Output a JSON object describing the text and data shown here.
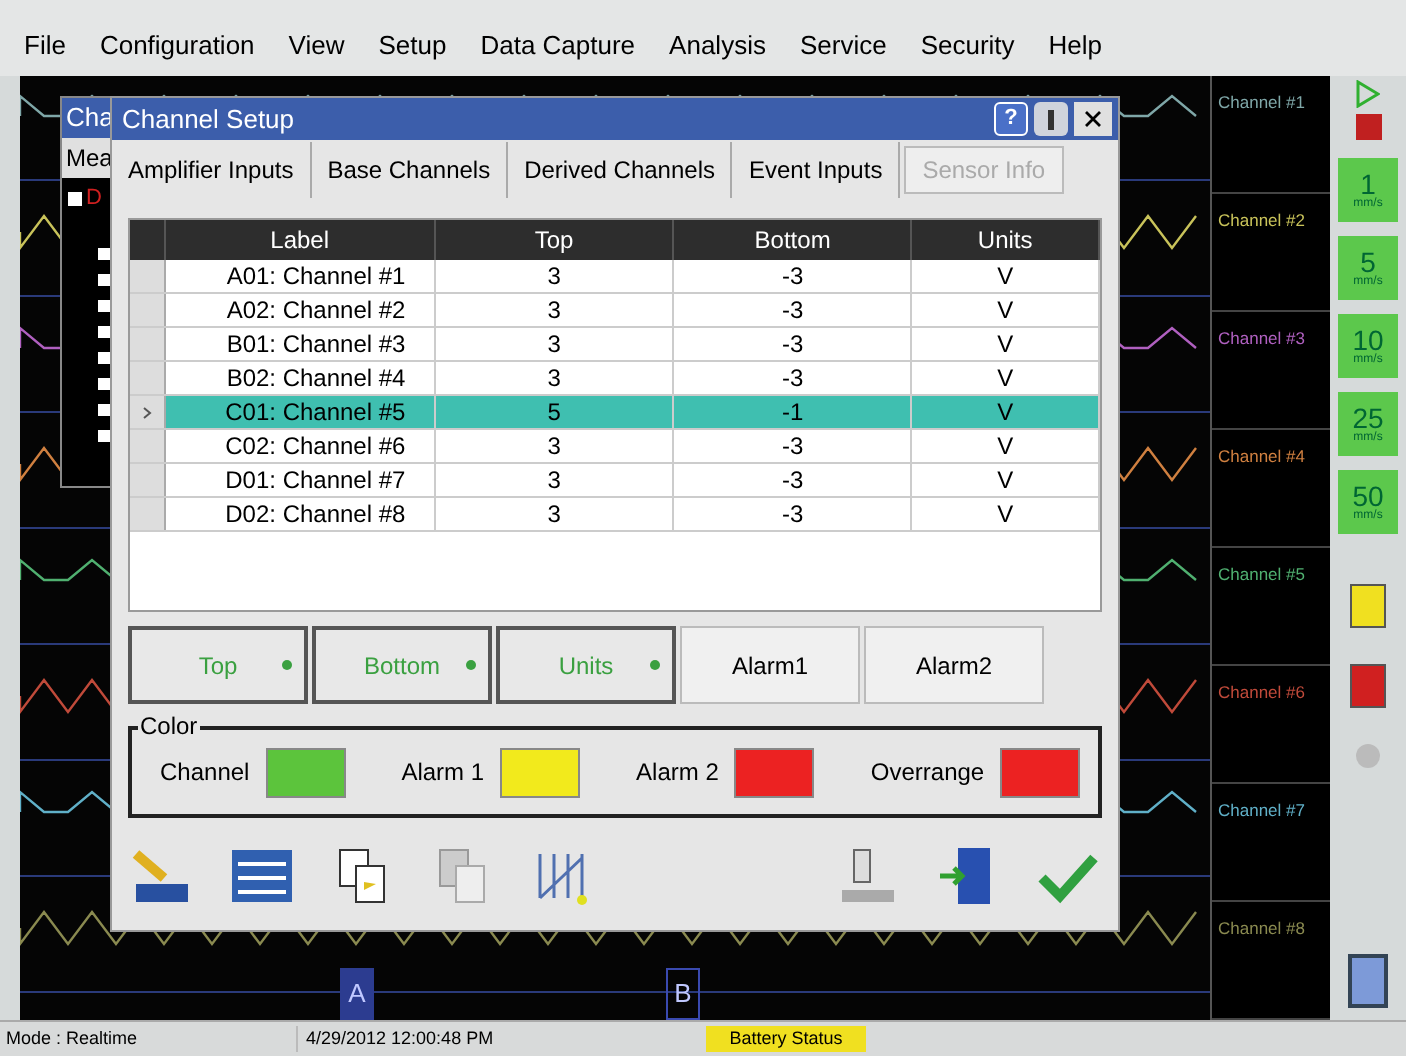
{
  "menu": [
    "File",
    "Configuration",
    "View",
    "Setup",
    "Data Capture",
    "Analysis",
    "Service",
    "Security",
    "Help"
  ],
  "background_window": {
    "title": "Cha",
    "tab": "Mea",
    "tree_item": "D"
  },
  "dialog": {
    "title": "Channel Setup",
    "help_glyph": "?",
    "tabs": [
      {
        "label": "Amplifier Inputs",
        "disabled": false
      },
      {
        "label": "Base Channels",
        "disabled": false
      },
      {
        "label": "Derived Channels",
        "disabled": false
      },
      {
        "label": "Event Inputs",
        "disabled": false
      },
      {
        "label": "Sensor Info",
        "disabled": true
      }
    ],
    "table": {
      "columns": [
        "Label",
        "Top",
        "Bottom",
        "Units"
      ],
      "rows": [
        {
          "cells": [
            "A01: Channel #1",
            "3",
            "-3",
            "V"
          ],
          "selected": false
        },
        {
          "cells": [
            "A02: Channel #2",
            "3",
            "-3",
            "V"
          ],
          "selected": false
        },
        {
          "cells": [
            "B01: Channel #3",
            "3",
            "-3",
            "V"
          ],
          "selected": false
        },
        {
          "cells": [
            "B02: Channel #4",
            "3",
            "-3",
            "V"
          ],
          "selected": false
        },
        {
          "cells": [
            "C01: Channel #5",
            "5",
            "-1",
            "V"
          ],
          "selected": true
        },
        {
          "cells": [
            "C02: Channel #6",
            "3",
            "-3",
            "V"
          ],
          "selected": false
        },
        {
          "cells": [
            "D01: Channel #7",
            "3",
            "-3",
            "V"
          ],
          "selected": false
        },
        {
          "cells": [
            "D02: Channel #8",
            "3",
            "-3",
            "V"
          ],
          "selected": false
        }
      ]
    },
    "column_buttons": [
      {
        "label": "Top",
        "selected": true
      },
      {
        "label": "Bottom",
        "selected": true
      },
      {
        "label": "Units",
        "selected": true
      },
      {
        "label": "Alarm1",
        "selected": false
      },
      {
        "label": "Alarm2",
        "selected": false
      }
    ],
    "color_group": {
      "title": "Color",
      "swatches": [
        {
          "label": "Channel",
          "color": "#5cc43c"
        },
        {
          "label": "Alarm 1",
          "color": "#f2ea1c"
        },
        {
          "label": "Alarm 2",
          "color": "#ec2222"
        },
        {
          "label": "Overrange",
          "color": "#ec2222"
        }
      ]
    }
  },
  "channels": [
    {
      "name": "Channel #1",
      "color": "#7fa7a8"
    },
    {
      "name": "Channel #2",
      "color": "#c9c35a"
    },
    {
      "name": "Channel #3",
      "color": "#b060c0"
    },
    {
      "name": "Channel #4",
      "color": "#d08040"
    },
    {
      "name": "Channel #5",
      "color": "#50b070"
    },
    {
      "name": "Channel #6",
      "color": "#c04a3a"
    },
    {
      "name": "Channel #7",
      "color": "#60b0c8"
    },
    {
      "name": "Channel #8",
      "color": "#8a8a50"
    }
  ],
  "cursors": [
    "A",
    "B"
  ],
  "speeds": [
    {
      "value": "1",
      "unit": "mm/s"
    },
    {
      "value": "5",
      "unit": "mm/s"
    },
    {
      "value": "10",
      "unit": "mm/s"
    },
    {
      "value": "25",
      "unit": "mm/s"
    },
    {
      "value": "50",
      "unit": "mm/s"
    }
  ],
  "status_bar": {
    "mode": "Mode : Realtime",
    "datetime": "4/29/2012 12:00:48 PM",
    "battery": "Battery Status"
  }
}
